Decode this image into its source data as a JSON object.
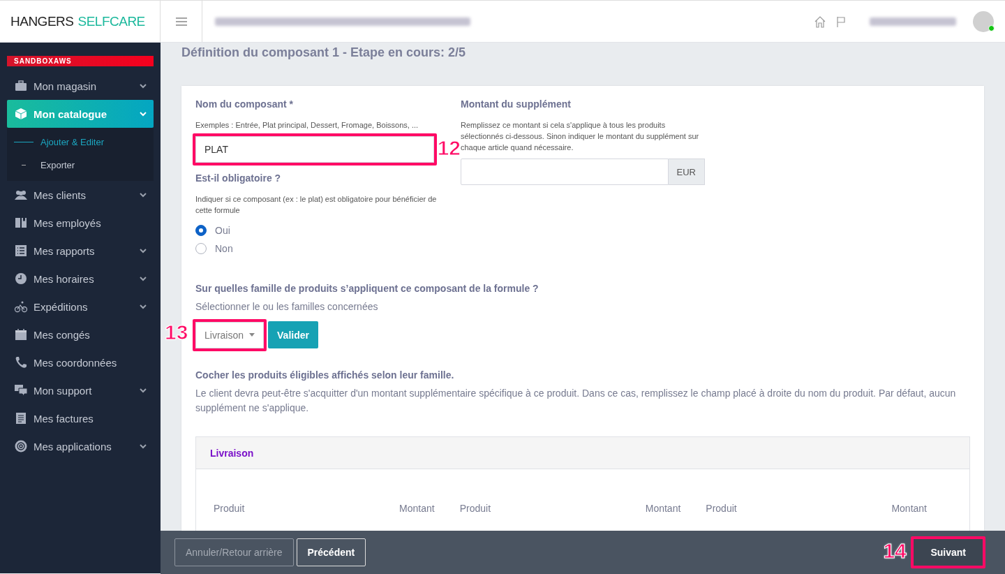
{
  "header": {
    "logo_dark": "HANGERS",
    "logo_accent": "SELFCARE",
    "user_online": true
  },
  "sidebar": {
    "environment_badge": "SANDBOXAWS",
    "items": [
      {
        "label": "Mon magasin",
        "expandable": true,
        "selected": false
      },
      {
        "label": "Mon catalogue",
        "expandable": true,
        "selected": true,
        "children": [
          {
            "label": "Ajouter & Editer",
            "selected": true
          },
          {
            "label": "Exporter",
            "selected": false
          }
        ]
      },
      {
        "label": "Mes clients",
        "expandable": true,
        "selected": false
      },
      {
        "label": "Mes employés",
        "expandable": false,
        "selected": false
      },
      {
        "label": "Mes rapports",
        "expandable": true,
        "selected": false
      },
      {
        "label": "Mes horaires",
        "expandable": true,
        "selected": false
      },
      {
        "label": "Expéditions",
        "expandable": true,
        "selected": false
      },
      {
        "label": "Mes congés",
        "expandable": false,
        "selected": false
      },
      {
        "label": "Mes coordonnées",
        "expandable": false,
        "selected": false
      },
      {
        "label": "Mon support",
        "expandable": true,
        "selected": false
      },
      {
        "label": "Mes factures",
        "expandable": false,
        "selected": false
      },
      {
        "label": "Mes applications",
        "expandable": true,
        "selected": false
      }
    ]
  },
  "page": {
    "title": "Définition du composant 1 - Etape en cours: 2/5",
    "name_field": {
      "label": "Nom du composant *",
      "hint": "Exemples : Entrée, Plat principal, Dessert, Fromage, Boissons, ...",
      "value": "PLAT",
      "callout": "12"
    },
    "supplement_field": {
      "label": "Montant du supplément",
      "hint": "Remplissez ce montant si cela s'applique à tous les produits sélectionnés ci-dessous. Sinon indiquer le montant du supplément sur chaque article quand nécessaire.",
      "unit": "EUR"
    },
    "mandatory": {
      "label": "Est-il obligatoire ?",
      "hint": "Indiquer si ce composant (ex : le plat) est obligatoire pour bénéficier de cette formule",
      "options": [
        {
          "label": "Oui",
          "selected": true
        },
        {
          "label": "Non",
          "selected": false
        }
      ]
    },
    "families": {
      "label": "Sur quelles famille de produits s’appliquent ce composant de la formule ?",
      "hint": "Sélectionner le ou les familles concernées",
      "dropdown": "Livraison",
      "button": "Valider",
      "callout": "13"
    },
    "products": {
      "label": "Cocher les produits éligibles affichés selon leur famille.",
      "hint": "Le client devra peut-être s'acquitter d'un montant supplémentaire spécifique à ce produit. Dans ce cas, remplissez le champ placé à droite du nom du produit. Par défaut, aucun supplément ne s'applique.",
      "group": {
        "title": "Livraison",
        "columns": [
          "Produit",
          "Montant",
          "Produit",
          "Montant",
          "Produit",
          "Montant"
        ]
      }
    }
  },
  "footer": {
    "buttons": [
      {
        "label": "Annuler/Retour arrière",
        "disabled": true
      },
      {
        "label": "Précédent",
        "disabled": false
      }
    ],
    "next": {
      "label": "Suivant",
      "callout": "14"
    }
  }
}
